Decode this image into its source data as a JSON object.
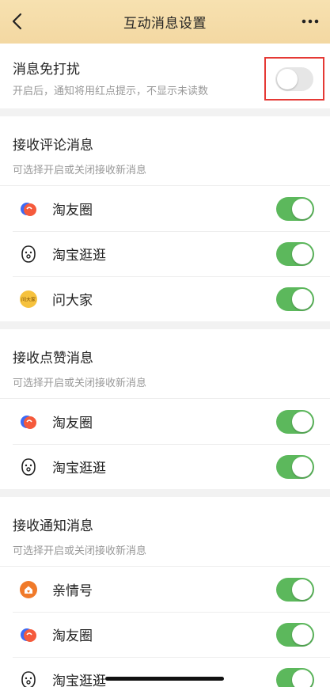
{
  "header": {
    "title": "互动消息设置"
  },
  "dnd": {
    "title": "消息免打扰",
    "subtitle": "开启后，通知将用红点提示，不显示未读数",
    "enabled": false
  },
  "sections": [
    {
      "title": "接收评论消息",
      "subtitle": "可选择开启或关闭接收新消息",
      "items": [
        {
          "name": "淘友圈",
          "icon": "taoyouquan-icon",
          "enabled": true
        },
        {
          "name": "淘宝逛逛",
          "icon": "guangguang-icon",
          "enabled": true
        },
        {
          "name": "问大家",
          "icon": "wendajia-icon",
          "icon_text": "问大家",
          "enabled": true
        }
      ]
    },
    {
      "title": "接收点赞消息",
      "subtitle": "可选择开启或关闭接收新消息",
      "items": [
        {
          "name": "淘友圈",
          "icon": "taoyouquan-icon",
          "enabled": true
        },
        {
          "name": "淘宝逛逛",
          "icon": "guangguang-icon",
          "enabled": true
        }
      ]
    },
    {
      "title": "接收通知消息",
      "subtitle": "可选择开启或关闭接收新消息",
      "items": [
        {
          "name": "亲情号",
          "icon": "qinqinghao-icon",
          "enabled": true
        },
        {
          "name": "淘友圈",
          "icon": "taoyouquan-icon",
          "enabled": true
        },
        {
          "name": "淘宝逛逛",
          "icon": "guangguang-icon",
          "enabled": true
        }
      ]
    }
  ],
  "colors": {
    "header_bg": "#f5dca8",
    "toggle_on": "#5cb85c",
    "toggle_off": "#e6e6e6",
    "highlight_border": "#e53935"
  }
}
